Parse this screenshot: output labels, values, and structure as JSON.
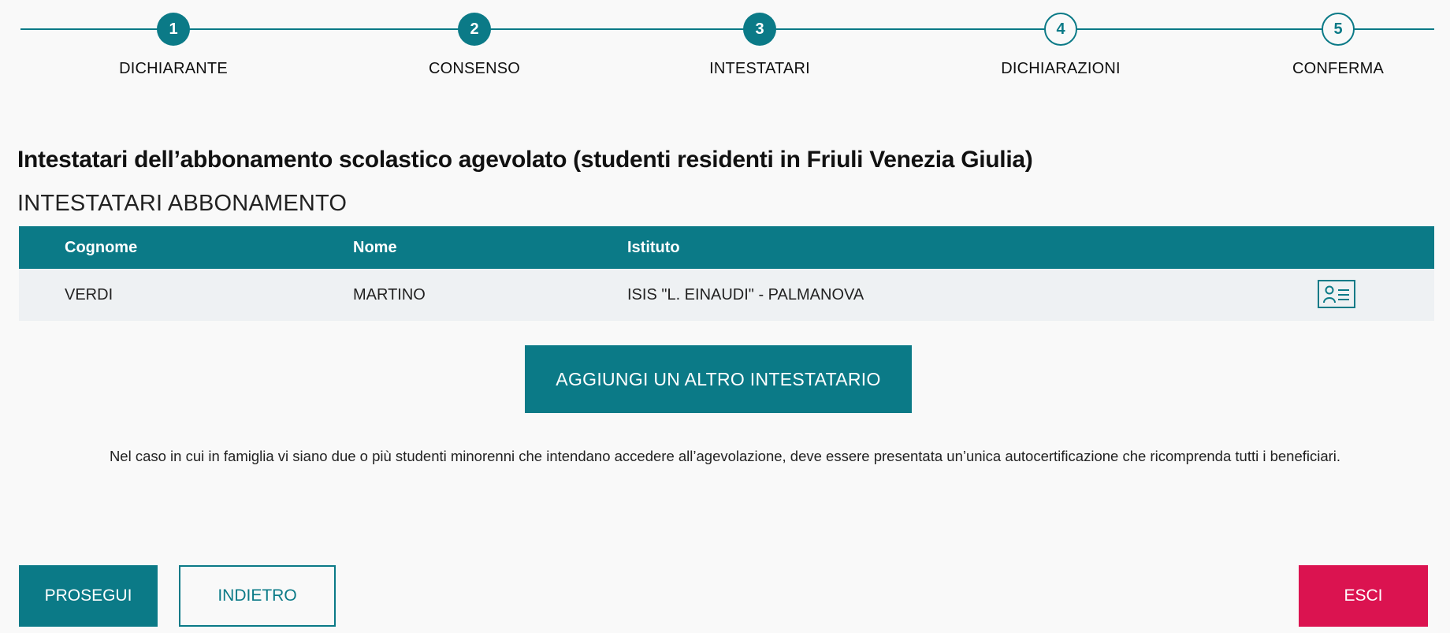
{
  "stepper": {
    "steps": [
      {
        "number": "1",
        "label": "DICHIARANTE",
        "state": "completed"
      },
      {
        "number": "2",
        "label": "CONSENSO",
        "state": "completed"
      },
      {
        "number": "3",
        "label": "INTESTATARI",
        "state": "current"
      },
      {
        "number": "4",
        "label": "DICHIARAZIONI",
        "state": "pending"
      },
      {
        "number": "5",
        "label": "CONFERMA",
        "state": "pending"
      }
    ]
  },
  "page_title": "Intestatari dell’abbonamento scolastico agevolato (studenti residenti in Friuli Venezia Giulia)",
  "section_title": "INTESTATARI ABBONAMENTO",
  "table": {
    "headers": [
      "Cognome",
      "Nome",
      "Istituto"
    ],
    "rows": [
      {
        "cognome": "VERDI",
        "nome": "MARTINO",
        "istituto": "ISIS \"L. EINAUDI\" - PALMANOVA",
        "action_icon": "user-card-icon"
      }
    ]
  },
  "add_button_label": "AGGIUNGI UN ALTRO INTESTATARIO",
  "note": "Nel caso in cui in famiglia vi siano due o più studenti minorenni che intendano accedere all’agevolazione, deve essere presentata un’unica autocertificazione che ricomprenda tutti i beneficiari.",
  "footer": {
    "prosegui_label": "PROSEGUI",
    "indietro_label": "INDIETRO",
    "esci_label": "ESCI"
  },
  "colors": {
    "primary": "#0b7a87",
    "danger": "#db1350",
    "row_background": "#eef1f3",
    "page_background": "#f9f9f9"
  }
}
